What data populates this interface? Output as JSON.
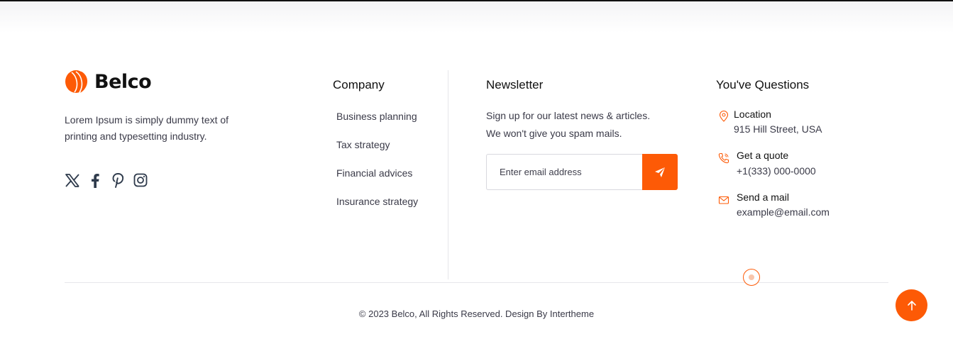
{
  "brand": {
    "name": "Belco",
    "logo_icon": "belco-logo-icon",
    "accent_color": "#fd5a06",
    "tagline": "Lorem Ipsum is simply dummy text of printing and typesetting industry."
  },
  "social": [
    {
      "icon": "x-twitter-icon"
    },
    {
      "icon": "facebook-icon"
    },
    {
      "icon": "pinterest-icon"
    },
    {
      "icon": "instagram-icon"
    }
  ],
  "company": {
    "title": "Company",
    "links": [
      "Business planning",
      "Tax strategy",
      "Financial advices",
      "Insurance strategy"
    ]
  },
  "newsletter": {
    "title": "Newsletter",
    "text_line1": "Sign up for our latest news & articles.",
    "text_line2": "We won't give you spam mails.",
    "input_placeholder": "Enter email address",
    "input_value": "",
    "submit_icon": "paper-plane-icon"
  },
  "questions": {
    "title": "You've Questions",
    "location_label": "Location",
    "location_value": "915 Hill Street, USA",
    "quote_label": "Get a quote",
    "quote_value": "+1(333) 000-0000",
    "mail_label": "Send a mail",
    "mail_value": "example@email.com"
  },
  "footer": {
    "copyright": "© 2023 Belco, All Rights Reserved. Design By Intertheme",
    "back_to_top_icon": "arrow-up-icon"
  }
}
